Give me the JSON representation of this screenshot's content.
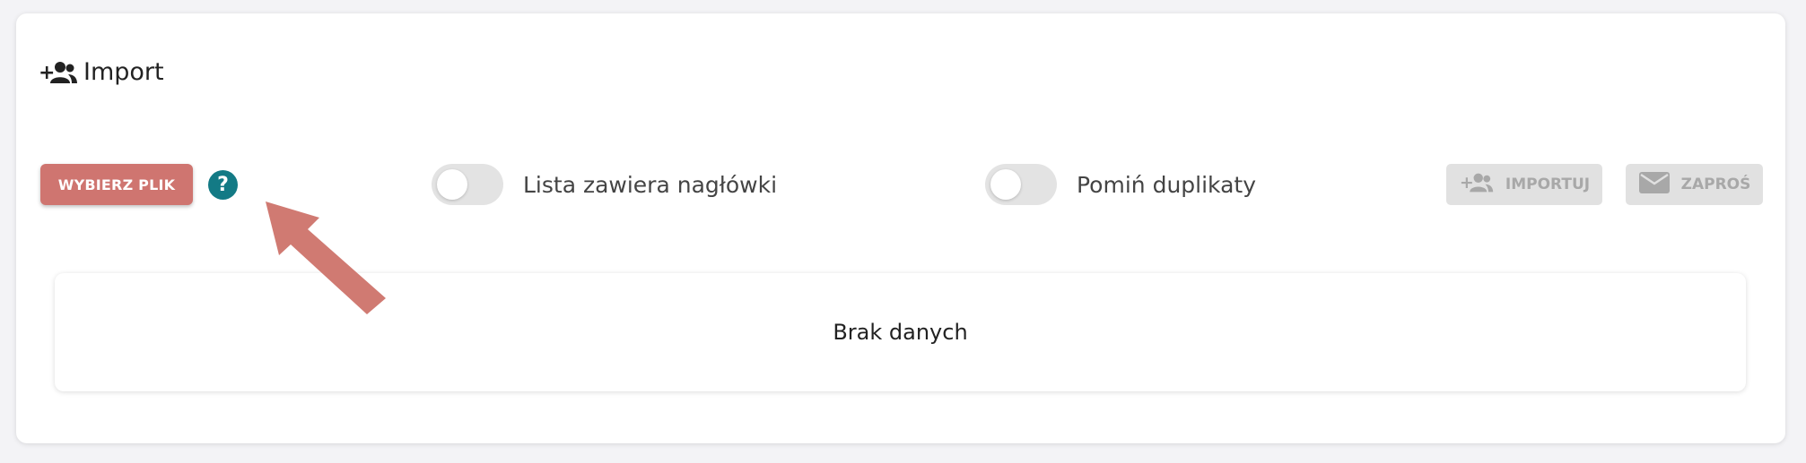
{
  "header": {
    "title": "Import",
    "icon": "add-users-icon"
  },
  "toolbar": {
    "choose_file_label": "WYBIERZ PLIK",
    "help_icon": "question-icon",
    "help_glyph": "?",
    "toggles": [
      {
        "label": "Lista zawiera nagłówki",
        "state": "off"
      },
      {
        "label": "Pomiń duplikaty",
        "state": "off"
      }
    ],
    "import_label": "IMPORTUJ",
    "invite_label": "ZAPROŚ"
  },
  "table": {
    "empty_text": "Brak danych"
  },
  "colors": {
    "primary_button": "#cf7570",
    "help": "#137a85",
    "disabled_button": "#e1e1e1",
    "arrow": "#d07a72"
  },
  "annotation": {
    "icon": "pointer-arrow-icon"
  }
}
